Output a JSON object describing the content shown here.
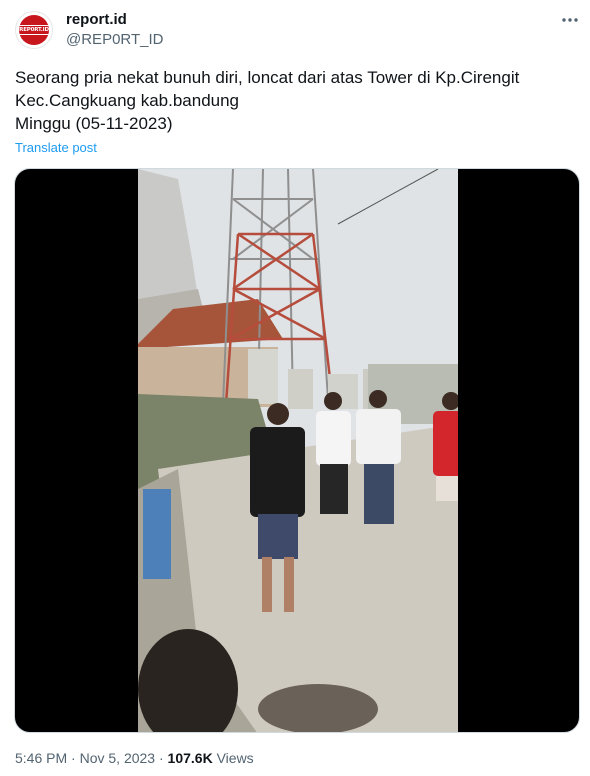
{
  "author": {
    "display_name": "report.id",
    "handle": "@REP0RT_ID",
    "avatar_text": "REP0RT.ID"
  },
  "tweet": {
    "lines": [
      "Seorang pria nekat bunuh diri, loncat dari atas Tower di Kp.Cirengit",
      "Kec.Cangkuang kab.bandung",
      "Minggu (05-11-2023)"
    ],
    "translate_label": "Translate post"
  },
  "meta": {
    "time": "5:46 PM",
    "separator": "·",
    "date": "Nov 5, 2023",
    "views_count": "107.6K",
    "views_label": "Views"
  },
  "icons": {
    "more": "more-horizontal-icon"
  },
  "colors": {
    "link": "#1d9bf0",
    "secondary_text": "#536471",
    "brand_red": "#c8161d"
  }
}
